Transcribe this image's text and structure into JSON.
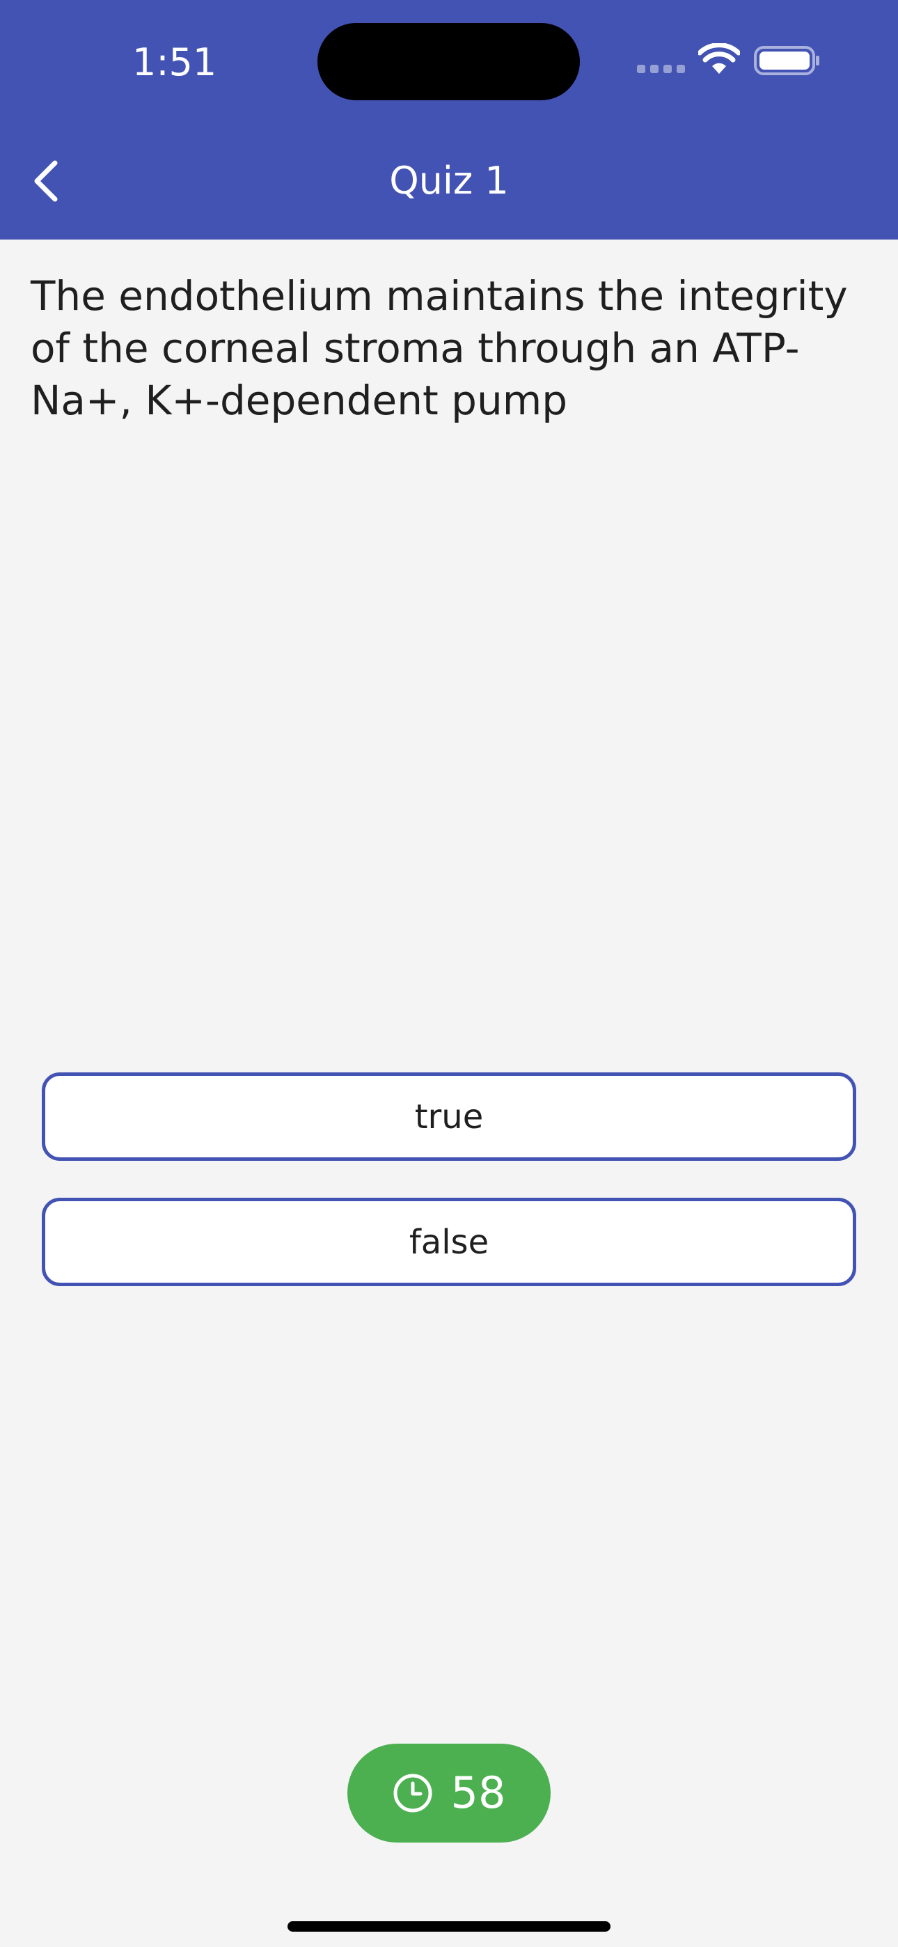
{
  "status_bar": {
    "time": "1:51"
  },
  "nav": {
    "title": "Quiz 1"
  },
  "question": {
    "text": "The endothelium maintains the integrity of the corneal stroma through an ATP-Na+, K+-dependent pump"
  },
  "options": [
    {
      "label": "true"
    },
    {
      "label": "false"
    }
  ],
  "timer": {
    "value": "58"
  },
  "colors": {
    "header": "#4353b3",
    "background": "#f4f4f5",
    "option_border": "#4353b3",
    "timer": "#4caf50"
  },
  "icons": {
    "back": "chevron-left-icon",
    "wifi": "wifi-icon",
    "battery": "battery-icon",
    "timer": "clock-icon"
  }
}
